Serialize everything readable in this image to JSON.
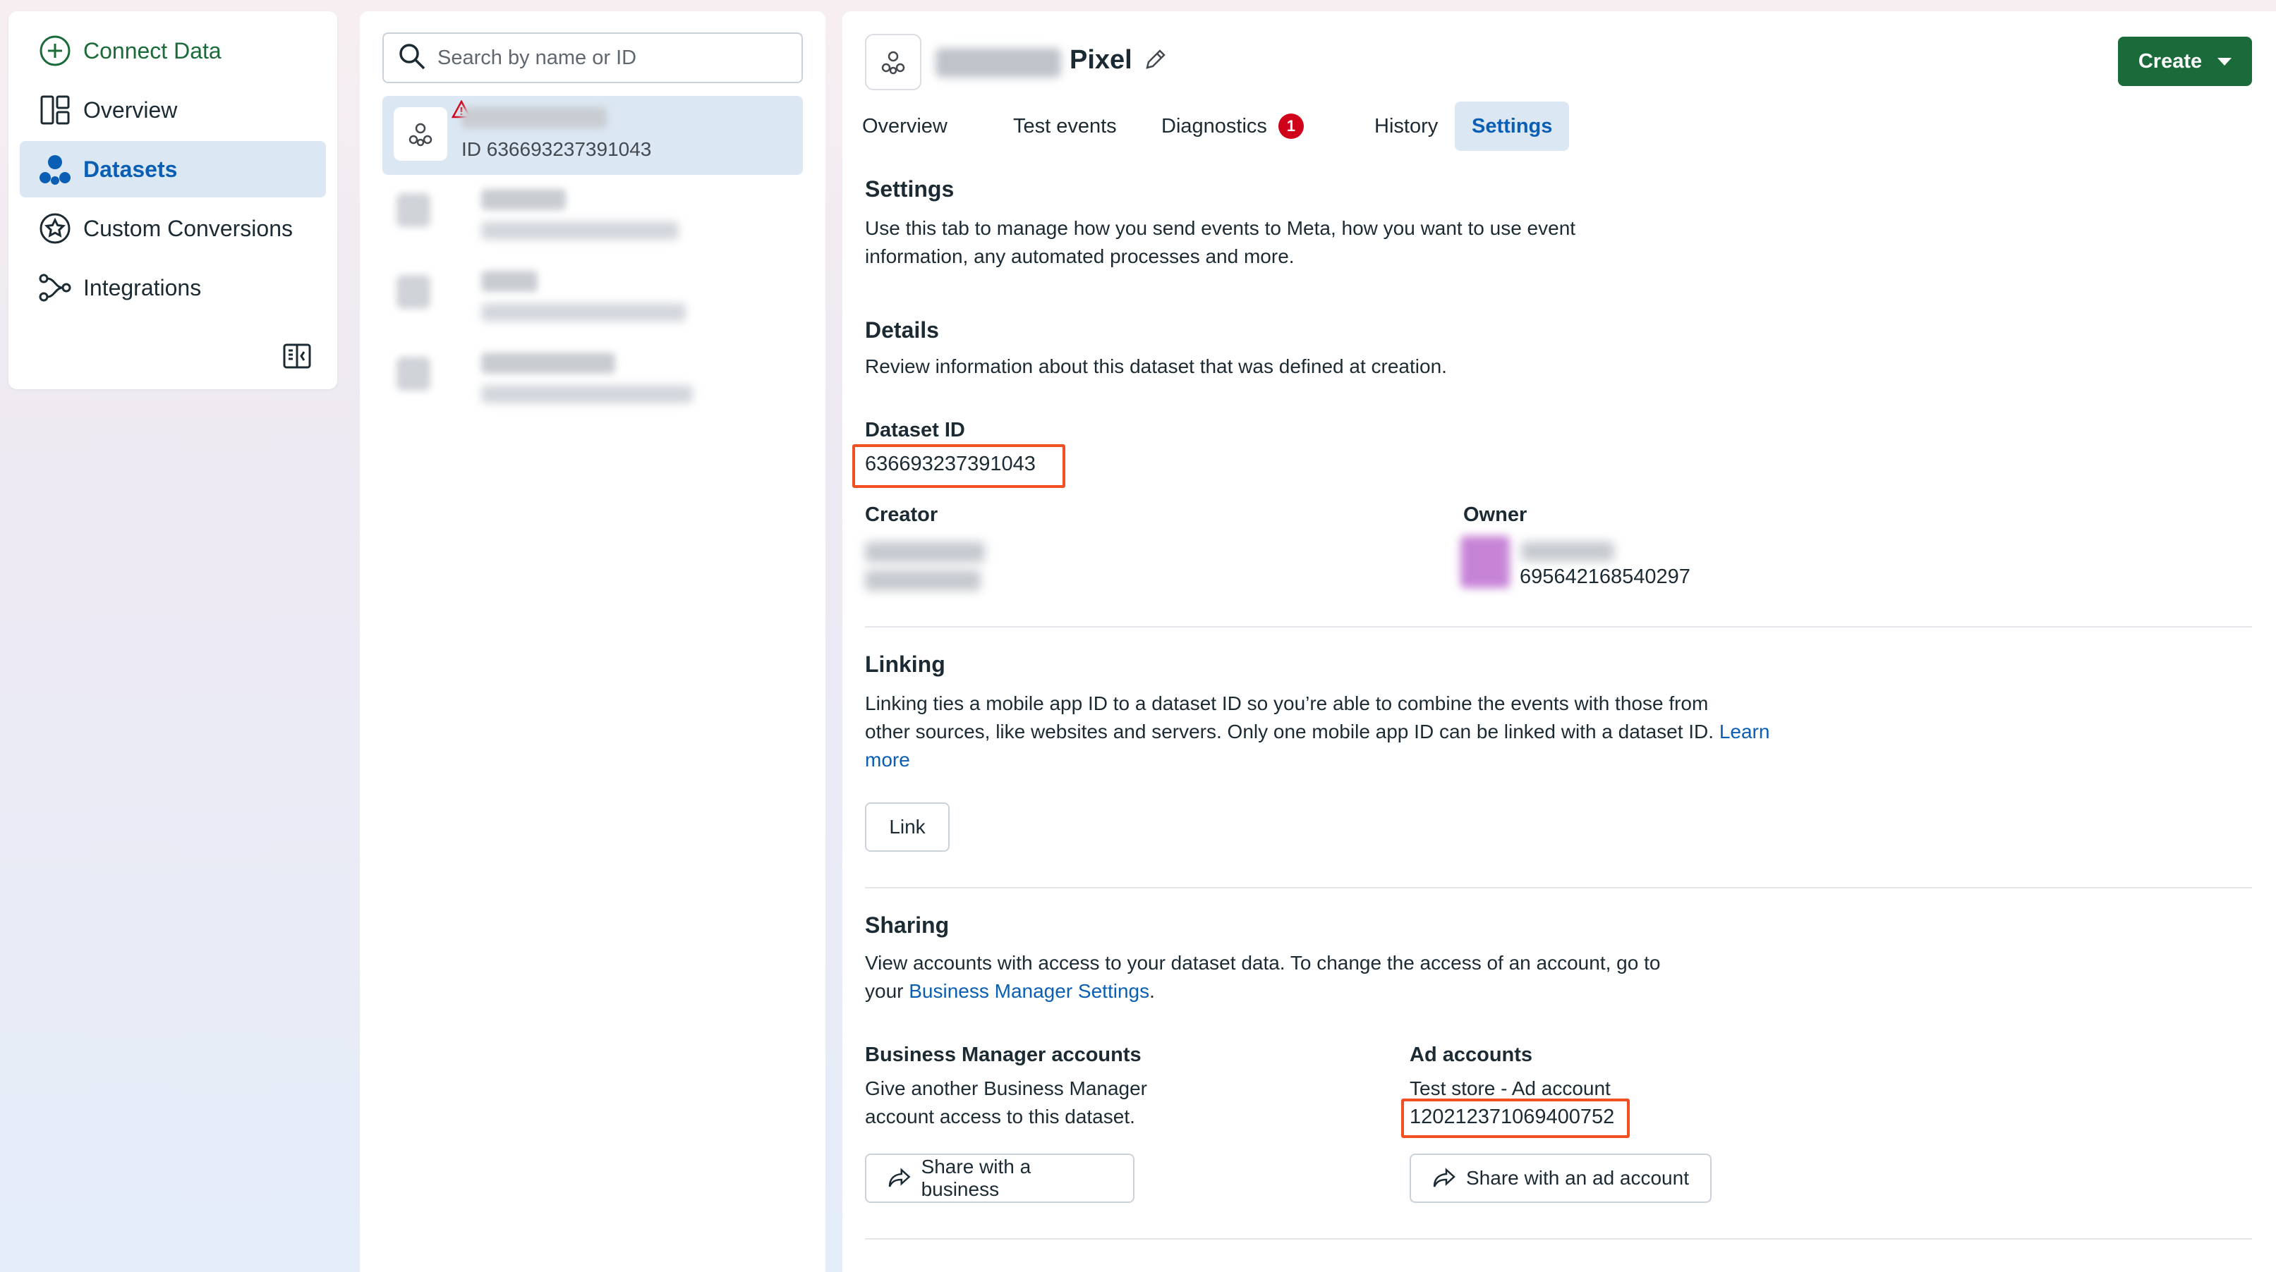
{
  "nav": {
    "items": [
      {
        "label": "Connect Data"
      },
      {
        "label": "Overview"
      },
      {
        "label": "Datasets"
      },
      {
        "label": "Custom Conversions"
      },
      {
        "label": "Integrations"
      }
    ]
  },
  "list": {
    "search_placeholder": "Search by name or ID",
    "selected_id": "ID 636693237391043"
  },
  "header": {
    "title": "Pixel",
    "create_label": "Create"
  },
  "tabs": [
    {
      "label": "Overview"
    },
    {
      "label": "Test events"
    },
    {
      "label": "Diagnostics",
      "badge": "1"
    },
    {
      "label": "History"
    },
    {
      "label": "Settings"
    }
  ],
  "settings": {
    "title": "Settings",
    "desc_line1": "Use this tab to manage how you send events to Meta, how you want to use event",
    "desc_line2": "information, any automated processes and more."
  },
  "details": {
    "title": "Details",
    "desc": "Review information about this dataset that was defined at creation.",
    "dataset_id_label": "Dataset ID",
    "dataset_id": "636693237391043",
    "creator_label": "Creator",
    "owner_label": "Owner",
    "owner_id": "695642168540297"
  },
  "linking": {
    "title": "Linking",
    "desc_line1": "Linking ties a mobile app ID to a dataset ID so you’re able to combine the events with those from",
    "desc_line2": "other sources, like websites and servers. Only one mobile app ID can be linked with a dataset ID.",
    "learn": "Learn",
    "more": "more",
    "link_button": "Link"
  },
  "sharing": {
    "title": "Sharing",
    "desc_line1": "View accounts with access to your dataset data. To change the access of an account, go to",
    "desc_prefix": "your",
    "settings_link": "Business Manager Settings",
    "desc_suffix": ".",
    "bm_title": "Business Manager accounts",
    "bm_desc_line1": "Give another Business Manager",
    "bm_desc_line2": "account access to this dataset.",
    "bm_button": "Share with a business",
    "ad_title": "Ad accounts",
    "ad_account_name": "Test store - Ad account",
    "ad_account_id": "120212371069400752",
    "ad_button": "Share with an ad account"
  },
  "colors": {
    "accent_green": "#1b6b3a",
    "accent_blue": "#0a5fb4",
    "highlight_red": "#f25022",
    "badge_red": "#d0021b"
  }
}
